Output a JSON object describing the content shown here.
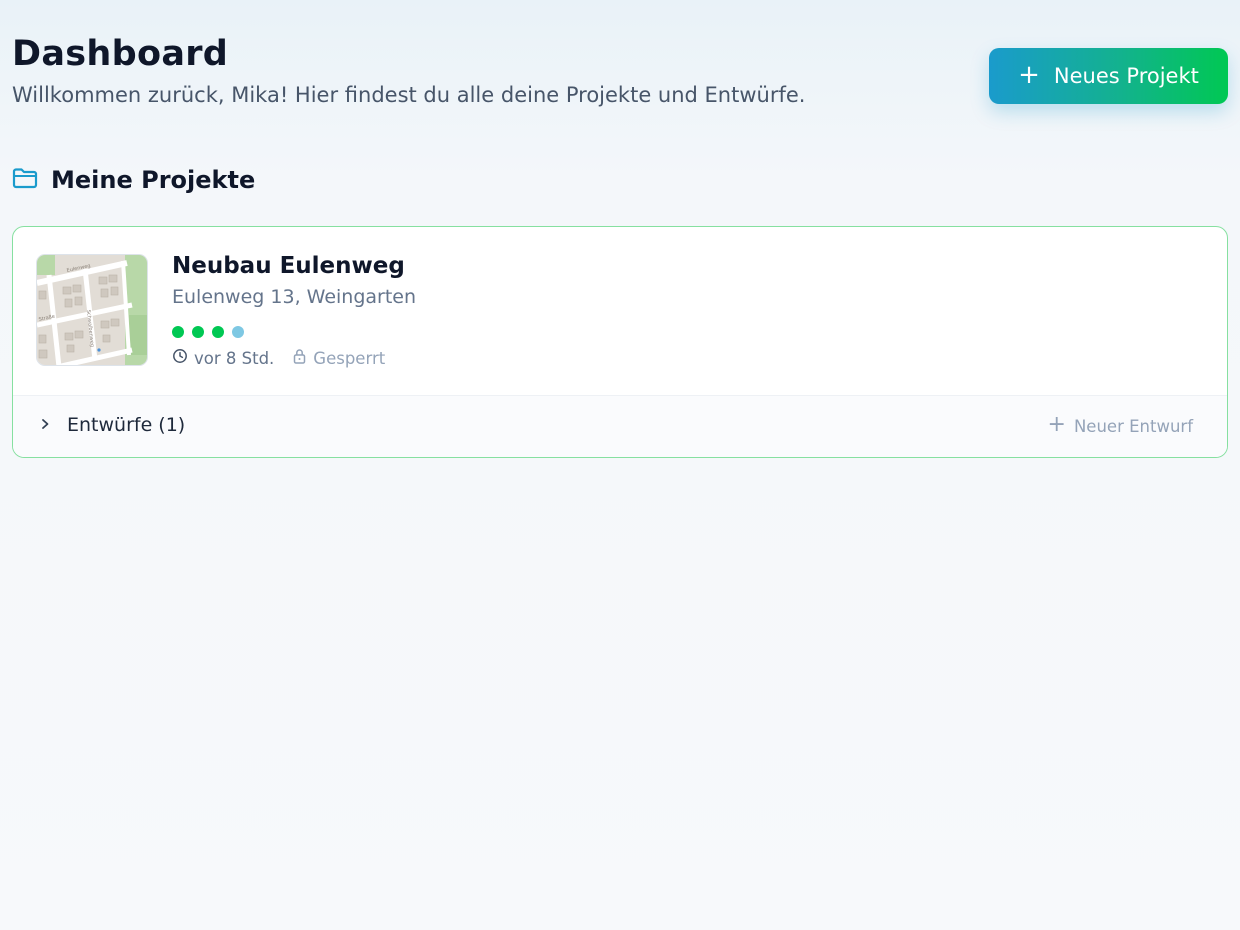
{
  "header": {
    "title": "Dashboard",
    "subtitle": "Willkommen zurück, Mika! Hier findest du alle deine Projekte und Entwürfe.",
    "new_project_label": "Neues Projekt",
    "new_project_icon": "plus-icon"
  },
  "section": {
    "title": "Meine Projekte",
    "icon": "folder-icon"
  },
  "projects": [
    {
      "name": "Neubau Eulenweg",
      "address": "Eulenweg 13, Weingarten",
      "thumbnail": "map-thumbnail",
      "progress_dots": [
        {
          "state": "done",
          "color": "#00c853"
        },
        {
          "state": "done",
          "color": "#00c853"
        },
        {
          "state": "done",
          "color": "#00c853"
        },
        {
          "state": "current",
          "color": "#7ec8e3"
        }
      ],
      "updated": "vor 8 Std.",
      "updated_icon": "clock-icon",
      "status": "Gesperrt",
      "status_icon": "lock-icon",
      "drafts_label": "Entwürfe (1)",
      "drafts_icon": "chevron-right-icon",
      "new_draft_label": "Neuer Entwurf",
      "new_draft_icon": "plus-icon"
    }
  ],
  "colors": {
    "accent_start": "#1a9bcc",
    "accent_end": "#00c853",
    "card_border": "#86e0a0",
    "title": "#0f172a",
    "muted": "#64748b"
  }
}
